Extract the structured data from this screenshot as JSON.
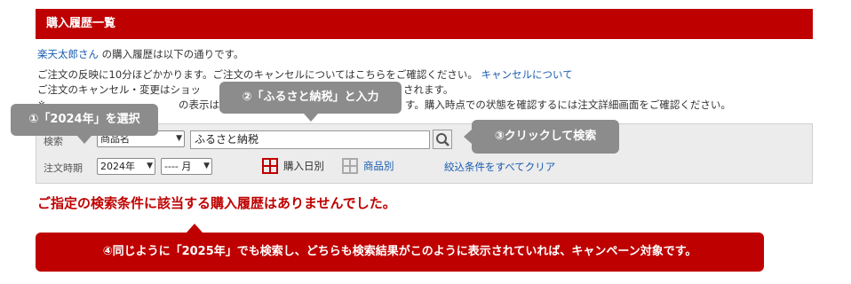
{
  "header": {
    "title": "購入履歴一覧"
  },
  "intro": {
    "user_link": "楽天太郎さん",
    "user_suffix": " の購入履歴は以下の通りです。",
    "line2": "ご注文の反映に10分ほどかかります。ご注文のキャンセルについてはこちらをご確認ください。",
    "cancel_link": "キャンセルについて",
    "line3_start": "ご注文のキャンセル・変更はショッ",
    "line3_end": "されます。",
    "line4_start": "※",
    "line4_mid": "の表示は現",
    "line4_end": "す。購入時点での状態を確認するには注文詳細画面をご確認ください。"
  },
  "search": {
    "label": "検索",
    "field_select": "商品名",
    "keyword": "ふるさと納税",
    "period_label": "注文時期",
    "year": "2024年",
    "month": "---- 月",
    "view_by_date": "購入日別",
    "view_by_item": "商品別",
    "clear_link": "絞込条件をすべてクリア"
  },
  "result": {
    "message": "ご指定の検索条件に該当する購入履歴はありませんでした。"
  },
  "callouts": {
    "step1": "①「2024年」を選択",
    "step2": "②「ふるさと納税」と入力",
    "step3": "③クリックして検索",
    "step4": "④同じように「2025年」でも検索し、どちらも検索結果がこのように表示されていれば、キャンペーン対象です。"
  },
  "colors": {
    "brand_red": "#bf0000",
    "callout_gray": "#8c8c8c",
    "link_blue": "#1a5cb0"
  },
  "icons": {
    "search": "magnifier-icon",
    "by_date": "grid-red-icon",
    "by_item": "grid-gray-icon"
  }
}
